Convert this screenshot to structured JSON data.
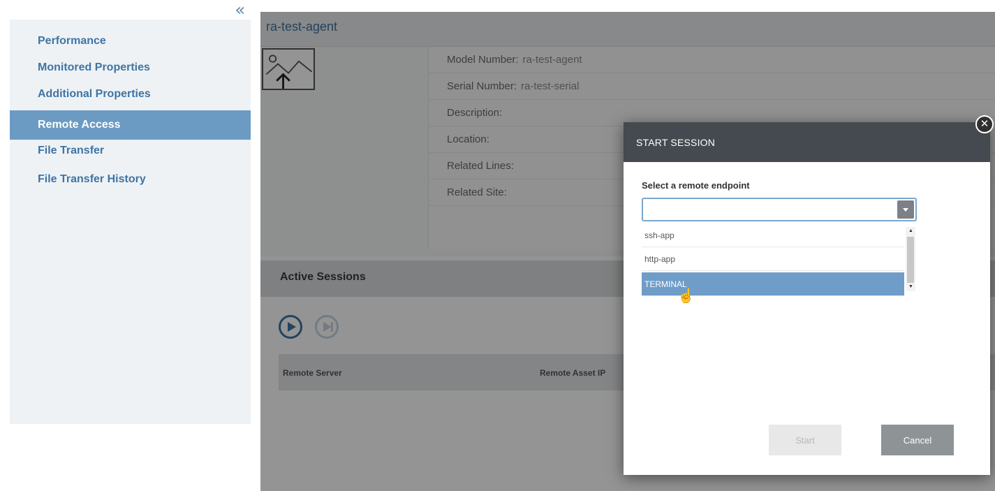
{
  "sidebar": {
    "collapse_label": "«",
    "items": [
      {
        "label": "Performance"
      },
      {
        "label": "Monitored Properties"
      },
      {
        "label": "Additional Properties"
      },
      {
        "label": "Remote Access"
      },
      {
        "label": "File Transfer"
      },
      {
        "label": "File Transfer History"
      }
    ]
  },
  "device": {
    "name": "ra-test-agent",
    "properties": [
      {
        "label": "Model Number:",
        "value": "ra-test-agent"
      },
      {
        "label": "Serial Number:",
        "value": "ra-test-serial"
      },
      {
        "label": "Description:",
        "value": ""
      },
      {
        "label": "Location:",
        "value": ""
      },
      {
        "label": "Related Lines:",
        "value": ""
      },
      {
        "label": "Related Site:",
        "value": ""
      }
    ]
  },
  "sessions": {
    "title": "Active Sessions",
    "columns": [
      "Remote Server",
      "Remote Asset IP"
    ]
  },
  "modal": {
    "title": "START SESSION",
    "close_label": "✕",
    "field_label": "Select a remote endpoint",
    "selected_value": "",
    "options": [
      "ssh-app",
      "http-app",
      "TERMINAL"
    ],
    "start_label": "Start",
    "cancel_label": "Cancel"
  }
}
